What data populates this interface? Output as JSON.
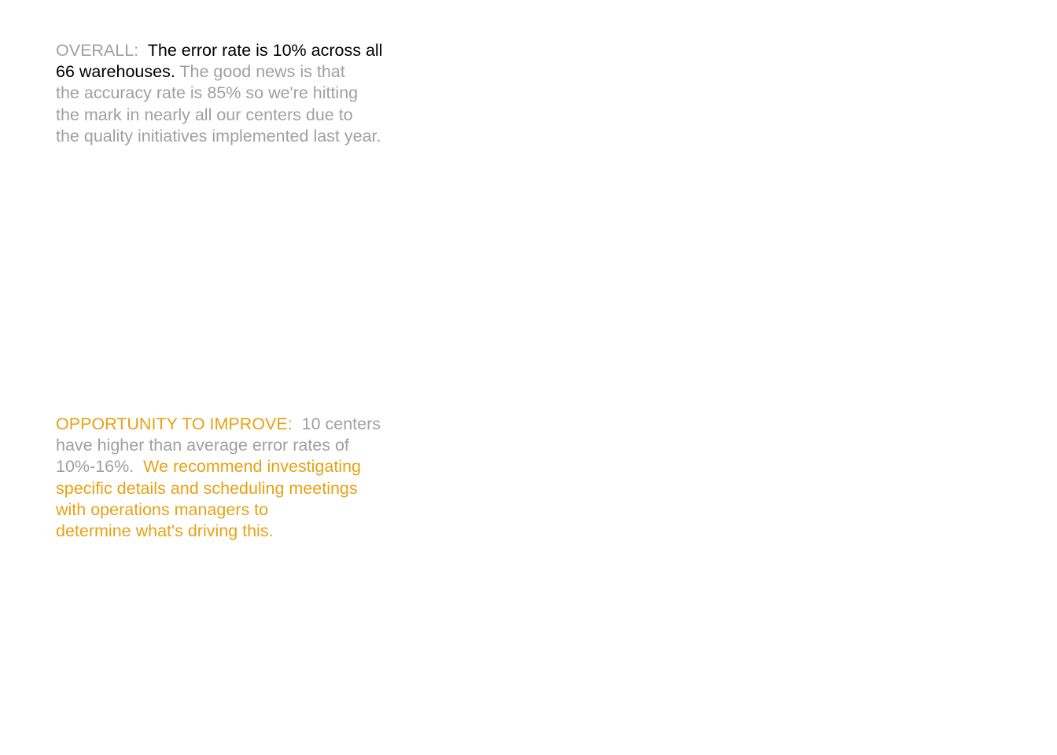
{
  "colors": {
    "gray_text": "#a0a0a0",
    "emphasis_text": "#000000",
    "accent_orange": "#e8a114",
    "background": "#ffffff"
  },
  "overall": {
    "label": "OVERALL:",
    "headline_line1": "The error rate is 10% across all",
    "headline_line2": "66 warehouses.",
    "detail_line2": "The good news is that",
    "detail_line3": "the accuracy rate is 85% so we're hitting",
    "detail_line4": "the mark in nearly all our centers due to",
    "detail_line5": "the quality initiatives implemented last year."
  },
  "opportunity": {
    "label": "OPPORTUNITY TO IMPROVE:",
    "detail_line1": "10 centers",
    "detail_line2": "have higher than average error rates of",
    "detail_line3": "10%-16%.",
    "recommend_line3": "We recommend investigating",
    "recommend_line4": "specific details and scheduling meetings",
    "recommend_line5": "with operations managers to",
    "recommend_line6": "determine what's driving this."
  }
}
